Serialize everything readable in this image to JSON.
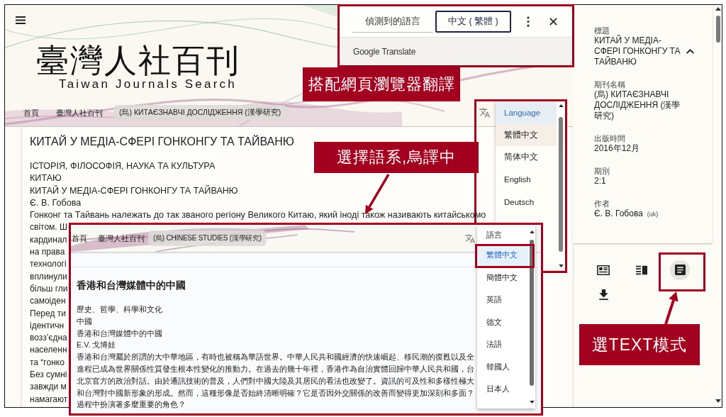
{
  "header": {
    "logo_title": "臺灣人社百刊",
    "logo_subtitle": "Taiwan Journals Search",
    "breadcrumb": [
      {
        "label": "首頁",
        "selected": false
      },
      {
        "label": "臺灣人社百刊",
        "selected": false
      },
      {
        "label": "(烏) КИТАЄЗНАВЧІ ДОСЛІДЖЕННЯ (漢學研究)",
        "selected": true
      }
    ]
  },
  "article": {
    "title": "КИТАЙ У МЕДІА-СФЕРІ ГОНКОНГУ ТА ТАЙВАНЮ",
    "lines": [
      "ІСТОРІЯ, ФІЛОСОФІЯ, НАУКА ТА КУЛЬТУРА",
      "КИТАЮ",
      "КИТАЙ У МЕДІА-СФЕРІ ГОНКОНГУ ТА ТАЙВАНЮ",
      "Є. В. Гобова",
      "Гонконг та Тайвань належать до так званого регіону Великого Китаю, який іноді також називають китайськомо",
      "світом. Ш",
      "кардинал",
      "на права",
      "технологі",
      "вплинули",
      "більш гли",
      "самоіден",
      "Перед ти",
      "ідентичн",
      "возз’єдна",
      "населенн",
      "та “гонко",
      "Без сумні",
      "завжди м",
      "намагают"
    ]
  },
  "sidebar": {
    "title_field": {
      "label": "標題",
      "value": "КИТАЙ У МЕДІА-СФЕРІ ГОНКОНГУ ТА ТАЙВАНЮ",
      "expanded": true
    },
    "fields": [
      {
        "label": "期刊名稱",
        "value": "(烏) КИТАЄЗНАВЧІ ДОСЛІДЖЕННЯ (漢學研究)"
      },
      {
        "label": "出版時間",
        "value": "2016年12月"
      },
      {
        "label": "期別",
        "value": "2:1"
      },
      {
        "label": "作者",
        "value": "Є. В. Гобова",
        "tag": "(uk)"
      }
    ],
    "view_modes": [
      {
        "kind": "article",
        "selected": false
      },
      {
        "kind": "columns",
        "selected": false
      },
      {
        "kind": "text",
        "selected": true
      }
    ]
  },
  "translate_popup": {
    "tabs": [
      {
        "label": "偵測到的語言",
        "selected": false
      },
      {
        "label": "中文 ( 繁體 )",
        "selected": true
      }
    ],
    "footer": "Google Translate"
  },
  "language_menu": {
    "items": [
      {
        "label": "Language",
        "selected": true,
        "hovered": false
      },
      {
        "label": "繁體中文",
        "selected": false,
        "hovered": true
      },
      {
        "label": "简体中文",
        "selected": false,
        "hovered": false
      },
      {
        "label": "English",
        "selected": false,
        "hovered": false
      },
      {
        "label": "Deutsch",
        "selected": false,
        "hovered": false
      }
    ]
  },
  "inset": {
    "breadcrumb": [
      {
        "label": "首頁",
        "selected": false
      },
      {
        "label": "臺灣人社百刊",
        "selected": false
      },
      {
        "label": "(烏) CHINESE STUDIES (漢學研究)",
        "selected": true
      }
    ],
    "title": "香港和台灣媒體中的中國",
    "lines": [
      "歷史、哲學、科學和文化",
      "中國",
      "香港和台灣媒體中的中國",
      "E.V. 戈博娃",
      "香港和台灣屬於所謂的大中華地區，有時也被稱為華語世界。中華人民共和國經濟的快速崛起、移民潮的復甦以及全",
      "進程已成為世界關係性質發生根本性變化的推動力。在過去的幾十年裡，香港作為自治實體回歸中華人民共和國，台",
      "北京官方的政治對話。由於通訊技術的普及，人們對中國大陸及其居民的看法也改變了。資訊的可及性和多樣性極大",
      "和台灣對中國新形象的形成。然而，這種形像是否始終清晰明確？它是否因外交關係的改善而變得更加深刻和多面？",
      "過程中扮演著多麼重要的角色？"
    ],
    "language_menu": {
      "items": [
        {
          "label": "語言",
          "selected": false
        },
        {
          "label": "繁體中文",
          "selected": true
        },
        {
          "label": "簡體中文",
          "selected": false
        },
        {
          "label": "英語",
          "selected": false
        },
        {
          "label": "德文",
          "selected": false
        },
        {
          "label": "法語",
          "selected": false
        },
        {
          "label": "韓國人",
          "selected": false
        },
        {
          "label": "日本人",
          "selected": false
        }
      ]
    }
  },
  "callouts": [
    "搭配網頁瀏覽器翻譯",
    "選擇語系,烏譯中",
    "選TEXT模式"
  ]
}
